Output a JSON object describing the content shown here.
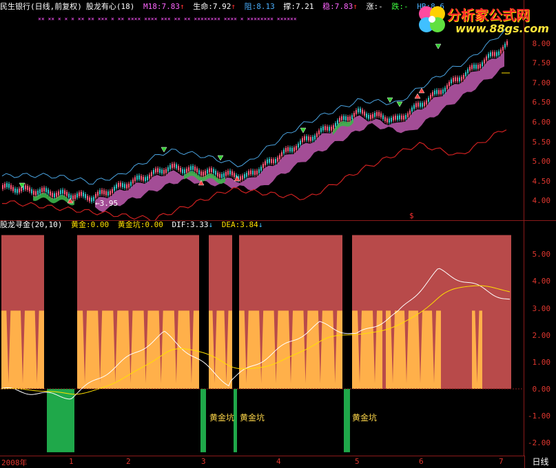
{
  "top_header": {
    "stock": "民生银行",
    "period": "(日线,前复权)",
    "indicator": "股龙有心(18)",
    "m18": "M18:7.83",
    "life": "生命:7.92",
    "resist": "阻:8.13",
    "support": "撑:7.21",
    "steady": "稳:7.83",
    "up": "涨:-",
    "down": "跌:-",
    "hb": "HB:8.6"
  },
  "top_axis": [
    "8.00",
    "7.50",
    "7.00",
    "6.50",
    "6.00",
    "5.50",
    "5.00",
    "4.50",
    "4.00"
  ],
  "low_marker": "3.95",
  "dollar_marker": "$",
  "bottom_header": {
    "indicator": "股龙寻金(20,10)",
    "gold": "黄金:0.00",
    "gold_pit": "黄金坑:0.00",
    "dif": "DIF:3.33",
    "dea": "DEA:3.84"
  },
  "bottom_axis": [
    "5.00",
    "4.00",
    "3.00",
    "2.00",
    "1.00",
    "0.00",
    "-1.00",
    "-2.00"
  ],
  "pit_labels": [
    "黄金坑",
    "黄金坑",
    "黄金坑"
  ],
  "x_axis": [
    "2008年",
    "1",
    "2",
    "3",
    "4",
    "5",
    "6",
    "7"
  ],
  "period_button": "日线",
  "logo": {
    "name": "分析家公式网",
    "url": "www.88gs.com"
  },
  "colors": {
    "background": "#000000",
    "axis": "#e0372f",
    "up_candle": "#ff5a7a",
    "down_candle": "#33c6c6",
    "band": "#c05ab0",
    "ma_red": "#cc2020",
    "bb": "#4aa3e0",
    "block_red": "#b84a4a",
    "block_orange": "#ffb04a",
    "pit_green": "#1fa84a",
    "dif": "#ffffff",
    "dea": "#ffe000"
  }
}
